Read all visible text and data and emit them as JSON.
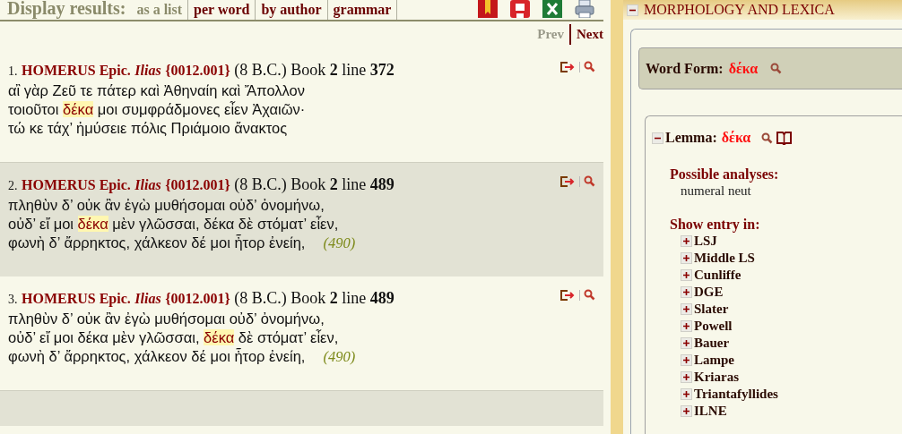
{
  "display_results": {
    "label": "Display results:",
    "options": [
      {
        "label": "as a list",
        "selected": true
      },
      {
        "label": "per word",
        "selected": false
      },
      {
        "label": "by author",
        "selected": false
      },
      {
        "label": "grammar",
        "selected": false
      }
    ]
  },
  "pager": {
    "prev": {
      "label": "Prev",
      "disabled": true
    },
    "next": {
      "label": "Next",
      "disabled": false
    }
  },
  "results": [
    {
      "number": "1.",
      "author": "HOMERUS Epic.",
      "work": "Ilias",
      "code": "{0012.001}",
      "date": "(8 B.C.)",
      "book_label": "Book",
      "book": "2",
      "line_label": "line",
      "line": "372",
      "lines": [
        [
          {
            "text": "αἲ γὰρ Ζεῦ τε πάτερ καὶ Ἀθηναίη καὶ Ἄπολλον",
            "highlight": false
          }
        ],
        [
          {
            "text": "τοιοῦτοι ",
            "highlight": false
          },
          {
            "text": "δέκα",
            "highlight": true
          },
          {
            "text": " μοι συμφράδμονες εἶεν Ἀχαιῶν·",
            "highlight": false
          }
        ],
        [
          {
            "text": "τώ κε τάχ’ ἠμύσειε πόλις Πριάμοιο ἄνακτος",
            "highlight": false
          }
        ]
      ]
    },
    {
      "number": "2.",
      "author": "HOMERUS Epic.",
      "work": "Ilias",
      "code": "{0012.001}",
      "date": "(8 B.C.)",
      "book_label": "Book",
      "book": "2",
      "line_label": "line",
      "line": "489",
      "lines": [
        [
          {
            "text": "πληθὺν δ’ οὐκ ἂν ἐγὼ μυθήσομαι οὐδ’ ὀνομήνω,",
            "highlight": false
          }
        ],
        [
          {
            "text": "οὐδ’ εἴ μοι ",
            "highlight": false
          },
          {
            "text": "δέκα",
            "highlight": true
          },
          {
            "text": " μὲν γλῶσσαι, δέκα δὲ στόματ’ εἶεν,",
            "highlight": false
          }
        ],
        [
          {
            "text": "φωνὴ δ’ ἄρρηκτος, χάλκεον δέ μοι ἦτορ ἐνείη,",
            "highlight": false
          }
        ]
      ],
      "ref": "(490)"
    },
    {
      "number": "3.",
      "author": "HOMERUS Epic.",
      "work": "Ilias",
      "code": "{0012.001}",
      "date": "(8 B.C.)",
      "book_label": "Book",
      "book": "2",
      "line_label": "line",
      "line": "489",
      "lines": [
        [
          {
            "text": "πληθὺν δ’ οὐκ ἂν ἐγὼ μυθήσομαι οὐδ’ ὀνομήνω,",
            "highlight": false
          }
        ],
        [
          {
            "text": "οὐδ’ εἴ μοι δέκα μὲν γλῶσσαι, ",
            "highlight": false
          },
          {
            "text": "δέκα",
            "highlight": true
          },
          {
            "text": " δὲ στόματ’ εἶεν,",
            "highlight": false
          }
        ],
        [
          {
            "text": "φωνὴ δ’ ἄρρηκτος, χάλκεον δέ μοι ἦτορ ἐνείη,",
            "highlight": false
          }
        ]
      ],
      "ref": "(490)"
    }
  ],
  "morphology": {
    "title": "MORPHOLOGY AND LEXICA",
    "expanded": true,
    "word_form": {
      "label": "Word Form:",
      "value": "δέκα"
    },
    "lemma": {
      "label": "Lemma:",
      "value": "δέκα",
      "expanded": true,
      "analyses_label": "Possible analyses:",
      "analyses": [
        "numeral neut"
      ],
      "entry_label": "Show entry in:",
      "lexica": [
        {
          "name": "LSJ",
          "expanded": false
        },
        {
          "name": "Middle LS",
          "expanded": false
        },
        {
          "name": "Cunliffe",
          "expanded": false
        },
        {
          "name": "DGE",
          "expanded": false
        },
        {
          "name": "Slater",
          "expanded": false
        },
        {
          "name": "Powell",
          "expanded": false
        },
        {
          "name": "Bauer",
          "expanded": false
        },
        {
          "name": "Lampe",
          "expanded": false
        },
        {
          "name": "Kriaras",
          "expanded": false
        },
        {
          "name": "Triantafyllides",
          "expanded": false
        },
        {
          "name": "ILNE",
          "expanded": false
        }
      ]
    }
  }
}
